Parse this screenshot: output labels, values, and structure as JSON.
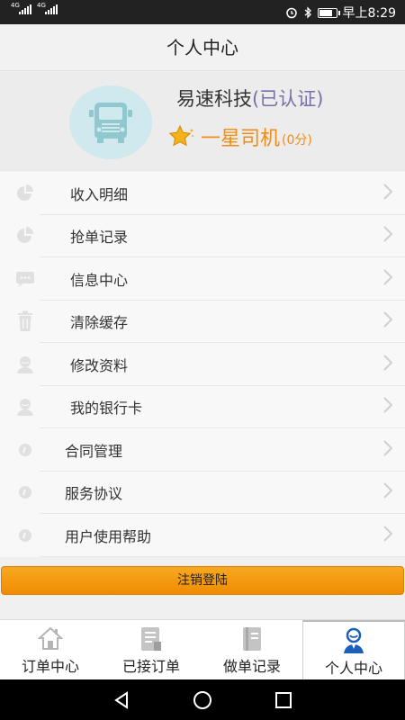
{
  "status_bar": {
    "signal_1": "4G",
    "signal_2": "4G",
    "time": "早上8:29"
  },
  "header": {
    "title": "个人中心"
  },
  "profile": {
    "company": "易速科技",
    "verified": "(已认证)",
    "level": "一星司机",
    "score": "(0分)",
    "accent_color": "#f28c13"
  },
  "menu": {
    "items": [
      {
        "label": "收入明细",
        "icon": "pie-chart-icon"
      },
      {
        "label": "抢单记录",
        "icon": "pie-chart-icon"
      },
      {
        "label": "信息中心",
        "icon": "message-icon"
      },
      {
        "label": "清除缓存",
        "icon": "trash-icon"
      },
      {
        "label": "修改资料",
        "icon": "user-icon"
      },
      {
        "label": "我的银行卡",
        "icon": "user-icon"
      },
      {
        "label": "合同管理",
        "icon": "info-icon"
      },
      {
        "label": "服务协议",
        "icon": "info-icon"
      },
      {
        "label": "用户使用帮助",
        "icon": "info-icon"
      }
    ]
  },
  "logout": {
    "label": "注销登陆",
    "color": "#f59e0b"
  },
  "tabbar": {
    "tabs": [
      {
        "label": "订单中心",
        "icon": "home-icon"
      },
      {
        "label": "已接订单",
        "icon": "document-icon"
      },
      {
        "label": "做单记录",
        "icon": "notebook-icon"
      },
      {
        "label": "个人中心",
        "icon": "person-icon",
        "active": true
      }
    ],
    "active_color": "#1b5fb8"
  }
}
